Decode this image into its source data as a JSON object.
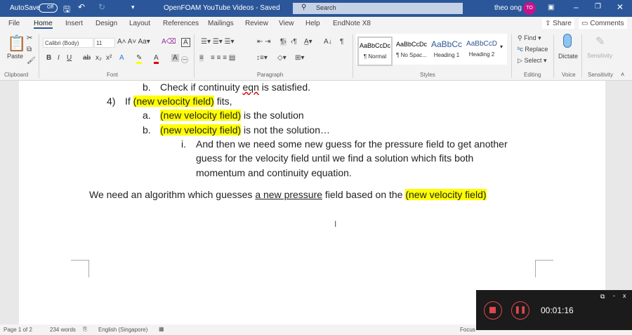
{
  "titlebar": {
    "autosave": "AutoSave",
    "autosave_state": "Off",
    "doc_title": "OpenFOAM YouTube Videos - Saved",
    "search_placeholder": "Search",
    "user_name": "theo ong",
    "user_initials": "TO",
    "avatar_color": "#c4148a",
    "accent": "#2b579a"
  },
  "tabs": [
    "File",
    "Home",
    "Insert",
    "Design",
    "Layout",
    "References",
    "Mailings",
    "Review",
    "View",
    "Help",
    "EndNote X8"
  ],
  "active_tab": "Home",
  "share": "Share",
  "comments": "Comments",
  "ribbon": {
    "clipboard": {
      "paste": "Paste",
      "label": "Clipboard"
    },
    "font": {
      "name": "Calibri (Body)",
      "size": "11",
      "label": "Font"
    },
    "paragraph": {
      "label": "Paragraph"
    },
    "styles": {
      "items": [
        {
          "preview": "AaBbCcDc",
          "name": "¶ Normal"
        },
        {
          "preview": "AaBbCcDc",
          "name": "¶ No Spac..."
        },
        {
          "preview": "AaBbCc",
          "name": "Heading 1"
        },
        {
          "preview": "AaBbCcD",
          "name": "Heading 2"
        }
      ],
      "label": "Styles"
    },
    "editing": {
      "find": "Find",
      "replace": "Replace",
      "select": "Select",
      "label": "Editing"
    },
    "voice": {
      "dictate": "Dictate",
      "label": "Voice"
    },
    "sensitivity": {
      "button": "Sensitivity",
      "label": "Sensitivity"
    }
  },
  "document": {
    "l1": {
      "marker": "b.",
      "text_a": "Check if continuity ",
      "text_b": "eqn",
      "text_c": " is satisfied."
    },
    "l2": {
      "marker": "4)",
      "text_a": "If ",
      "hl": "(new velocity field)",
      "text_b": " fits,"
    },
    "l3": {
      "marker": "a.",
      "hl": "(new velocity field)",
      "text": " is the solution"
    },
    "l4": {
      "marker": "b.",
      "hl": "(new velocity field)",
      "text": " is not the solution…"
    },
    "l5": {
      "marker": "i.",
      "lines": [
        "And then we need some new guess for the pressure field to get another",
        "guess for the velocity field until we find a solution which fits both",
        "momentum and continuity equation."
      ]
    },
    "l6": {
      "text_a": "We need an algorithm which guesses ",
      "ul": "a new pressure",
      "text_b": " field based on the ",
      "hl": "(new velocity field)"
    }
  },
  "status": {
    "page": "Page 1 of 2",
    "words": "234 words",
    "language": "English (Singapore)",
    "focus": "Focus"
  },
  "recorder": {
    "time": "00:01:16"
  }
}
